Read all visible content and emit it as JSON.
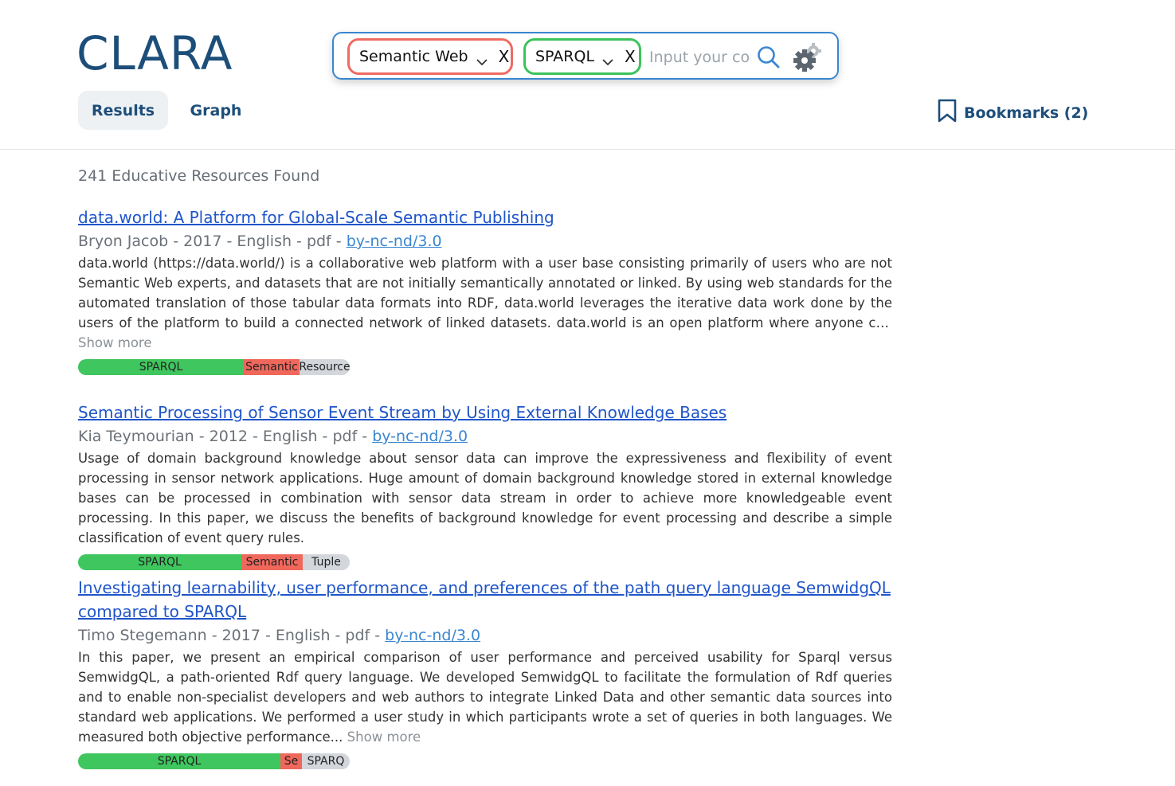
{
  "app": {
    "logo": "CLARA"
  },
  "search": {
    "chips": [
      {
        "label": "Semantic Web",
        "remove": "X",
        "color": "#ee6b62"
      },
      {
        "label": "SPARQL",
        "remove": "X",
        "color": "#3cc35b"
      }
    ],
    "input_value": "",
    "placeholder": "Input your concept",
    "icons": {
      "search": "search-icon",
      "settings": "gear-icon",
      "dropdown": "chevron-down-icon"
    }
  },
  "tabs": [
    {
      "label": "Results",
      "active": true
    },
    {
      "label": "Graph",
      "active": false
    }
  ],
  "bookmarks": {
    "label": "Bookmarks (2)",
    "icon": "bookmark-icon"
  },
  "results_count": "241 Educative Resources Found",
  "results": [
    {
      "title": "data.world: A Platform for Global-Scale Semantic Publishing",
      "meta": "Bryon Jacob - 2017 - English - pdf - ",
      "license": "by-nc-nd/3.0",
      "description": "data.world (https://data.world/) is a collaborative web platform with a user base consisting primarily of users who are not Semantic Web experts, and datasets that are not initially semantically annotated or linked. By using web standards for the automated translation of those tabular data formats into RDF, data.world leverages the iterative data work done by the users of the platform to build a connected network of linked datasets. data.world is an open platform where anyone can sign up for a free account.",
      "show_more": "Show more",
      "tags": [
        "SPARQL",
        "Semantic",
        "Resource"
      ]
    },
    {
      "title": "Semantic Processing of Sensor Event Stream by Using External Knowledge Bases",
      "meta": "Kia Teymourian - 2012 - English - pdf - ",
      "license": "by-nc-nd/3.0",
      "description": "Usage of domain background knowledge about sensor data can improve the expressiveness and flexibility of event processing in sensor network applications. Huge amount of domain background knowledge stored in external knowledge bases can be processed in combination with sensor data stream in order to achieve more knowledgeable event processing. In this paper, we discuss the benefits of background knowledge for event processing and describe a simple classification of event query rules.",
      "tags": [
        "SPARQL",
        "Semantic",
        "Tuple"
      ]
    },
    {
      "title": "Investigating learnability, user performance, and preferences of the path query language SemwidgQL compared to SPARQL",
      "meta": "Timo Stegemann - 2017 - English - pdf - ",
      "license": "by-nc-nd/3.0",
      "description": "In this paper, we present an empirical comparison of user performance and perceived usability for Sparql versus SemwidgQL, a path-oriented Rdf query language. We developed SemwidgQL to facilitate the formulation of Rdf queries and to enable non-specialist developers and web authors to integrate Linked Data and other semantic data sources into standard web applications. We performed a user study in which participants wrote a set of queries in both languages. We measured both objective performance...",
      "show_more": "Show more",
      "tags": [
        "SPARQL",
        "Se",
        "SPARQ"
      ]
    }
  ],
  "colors": {
    "brand": "#1d4e7a",
    "link": "#1f55c9",
    "accent": "#3a86d0",
    "tag_green": "#3fc65e",
    "tag_red": "#f0675c",
    "tag_grey": "#d3d7dc"
  }
}
